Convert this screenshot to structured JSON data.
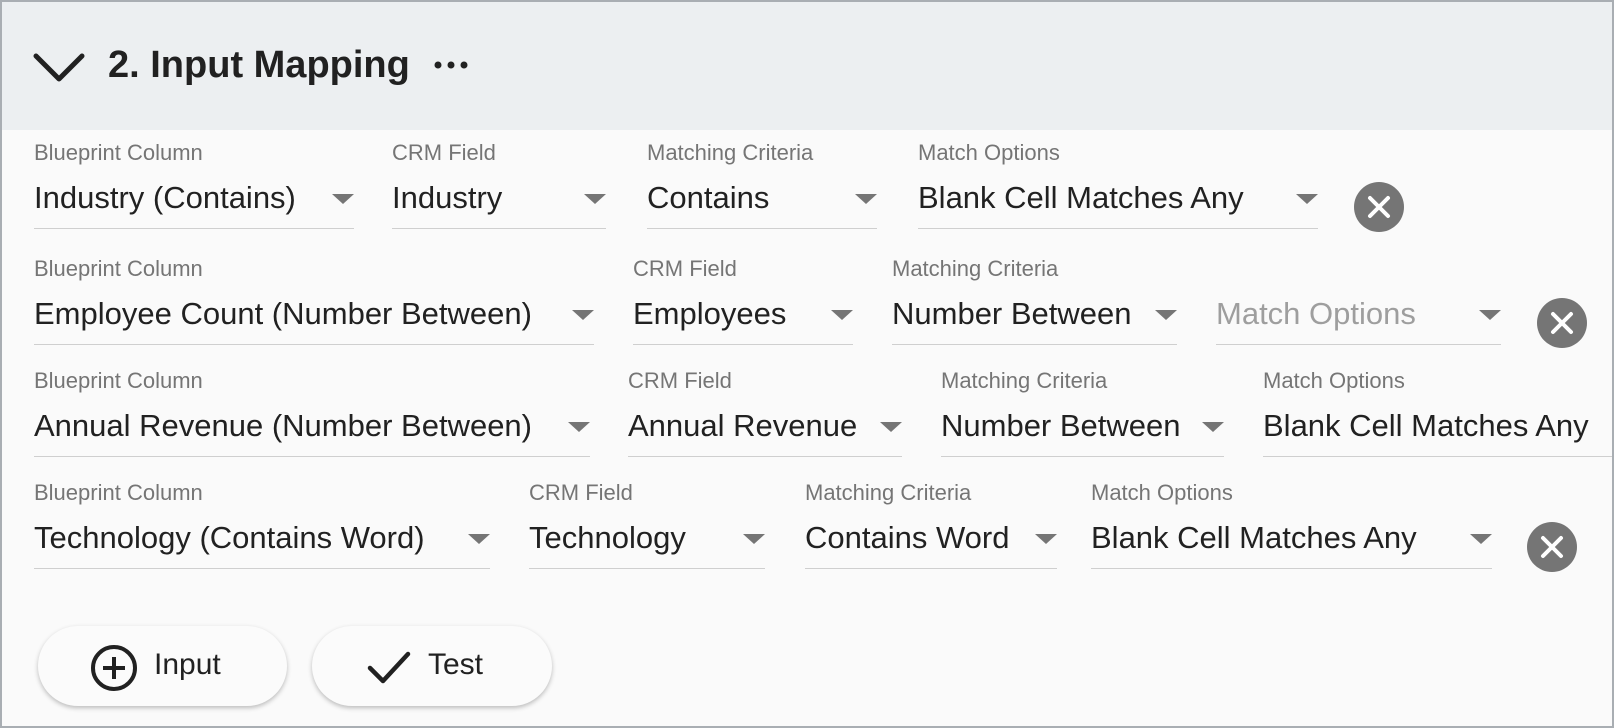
{
  "section": {
    "title": "2. Input Mapping",
    "collapse_icon": "chevron-down-icon",
    "more_icon": "more-horizontal-icon"
  },
  "labels": {
    "blueprint_column": "Blueprint Column",
    "crm_field": "CRM Field",
    "matching_criteria": "Matching Criteria",
    "match_options": "Match Options"
  },
  "rows": [
    {
      "blueprint_column": "Industry (Contains)",
      "crm_field": "Industry",
      "matching_criteria": "Contains",
      "match_options": "Blank Cell Matches Any"
    },
    {
      "blueprint_column": "Employee Count (Number Between)",
      "crm_field": "Employees",
      "matching_criteria": "Number Between",
      "match_options": "Match Options"
    },
    {
      "blueprint_column": "Annual Revenue (Number Between)",
      "crm_field": "Annual Revenue",
      "matching_criteria": "Number Between",
      "match_options": "Blank Cell Matches Any"
    },
    {
      "blueprint_column": "Technology (Contains Word)",
      "crm_field": "Technology",
      "matching_criteria": "Contains Word",
      "match_options": "Blank Cell Matches Any"
    }
  ],
  "actions": {
    "add_input_label": "Input",
    "test_label": "Test"
  },
  "colors": {
    "header_bg": "#eceff1",
    "panel_bg": "#fafafa",
    "remove_icon": "#757575"
  }
}
